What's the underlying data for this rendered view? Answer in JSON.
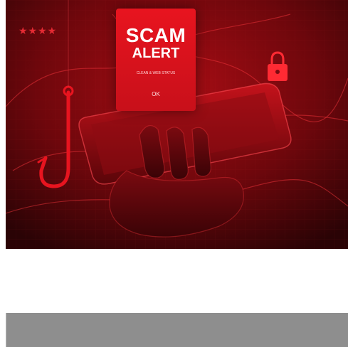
{
  "illustration": {
    "alert_title": "SCAM",
    "alert_subtitle": "ALERT",
    "alert_message": "CLEAN & WEB STATUS",
    "alert_ok": "OK",
    "password_mask": "★★★★",
    "icons": [
      "lock-icon",
      "fishing-hook-icon",
      "smartphone-icon",
      "hand-icon"
    ],
    "colors": {
      "background_dark": "#3a0507",
      "background_mid": "#8a0b10",
      "accent_red": "#e8141f",
      "glow": "#ff3a40"
    }
  },
  "bottom_bar": {
    "color": "#8e8e8e"
  }
}
